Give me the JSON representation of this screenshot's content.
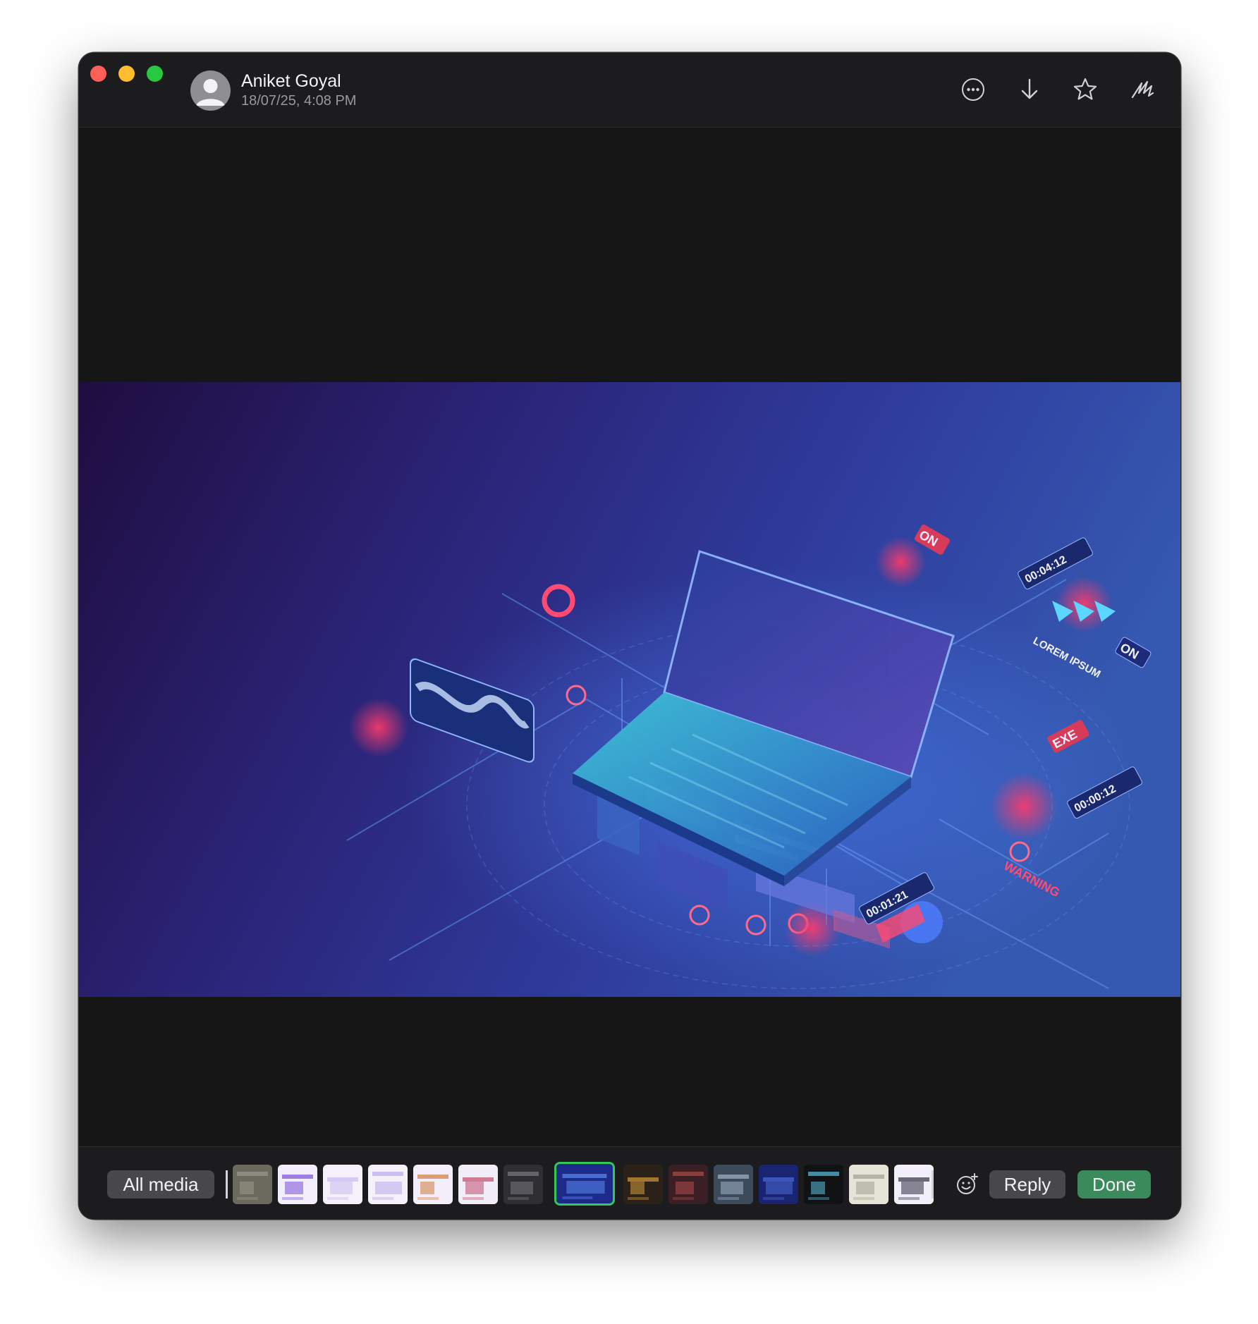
{
  "window": {
    "sender_name": "Aniket Goyal",
    "timestamp": "18/07/25, 4:08 PM"
  },
  "toolbar": {
    "icons": [
      "more-icon",
      "download-icon",
      "star-icon",
      "markup-icon"
    ]
  },
  "media": {
    "labels": [
      "ON",
      "ON",
      "00:04:12",
      "LOREM IPSUM",
      "EXE",
      "00:00:12",
      "WARNING",
      "00:01:21"
    ]
  },
  "bottom_bar": {
    "all_media_label": "All media",
    "reply_label": "Reply",
    "done_label": "Done",
    "thumbnails": [
      {
        "name": "thumb-1",
        "bg": "#6b6a5e",
        "accent": "#9a9a8a"
      },
      {
        "name": "thumb-2",
        "bg": "#f3eefc",
        "accent": "#7a4fd6"
      },
      {
        "name": "thumb-3",
        "bg": "#f4f1fb",
        "accent": "#c8b9f0"
      },
      {
        "name": "thumb-4",
        "bg": "#f4f1fb",
        "accent": "#b9a8ec"
      },
      {
        "name": "thumb-5",
        "bg": "#f3eefa",
        "accent": "#d07a3a"
      },
      {
        "name": "thumb-6",
        "bg": "#f2eef8",
        "accent": "#c04a6a"
      },
      {
        "name": "thumb-7",
        "bg": "#2e2e33",
        "accent": "#7a7a80"
      },
      {
        "name": "thumb-8",
        "bg": "#1e2a8a",
        "accent": "#5a8af0",
        "selected": true
      },
      {
        "name": "thumb-9",
        "bg": "#2a2218",
        "accent": "#d49a3a"
      },
      {
        "name": "thumb-10",
        "bg": "#3a1f24",
        "accent": "#b04a4a"
      },
      {
        "name": "thumb-11",
        "bg": "#3c4a5a",
        "accent": "#a0b4c8"
      },
      {
        "name": "thumb-12",
        "bg": "#1a2470",
        "accent": "#4a6ad8"
      },
      {
        "name": "thumb-13",
        "bg": "#101214",
        "accent": "#5ac0e0"
      },
      {
        "name": "thumb-14",
        "bg": "#e6e4d6",
        "accent": "#a0a090"
      },
      {
        "name": "thumb-15",
        "bg": "#f2eefa",
        "accent": "#303040"
      }
    ]
  }
}
